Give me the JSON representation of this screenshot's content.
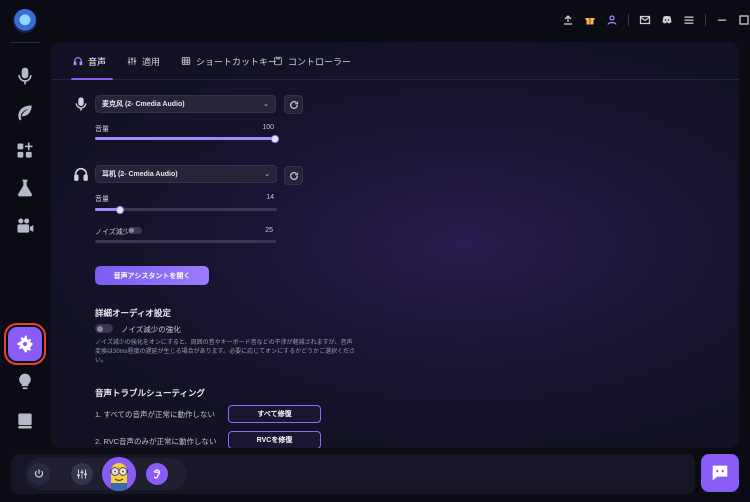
{
  "tabs": [
    {
      "label": "音声"
    },
    {
      "label": "適用"
    },
    {
      "label": "ショートカットキー"
    },
    {
      "label": "コントローラー"
    }
  ],
  "microphone": {
    "device": "麦克风 (2- Cmedia Audio)",
    "volume_label": "音量",
    "volume_value": "100",
    "volume_level": 1.0
  },
  "headphones": {
    "device": "耳机 (2- Cmedia Audio)",
    "volume_label": "音量",
    "volume_value": "14",
    "volume_level": 0.14,
    "noise_label": "ノイズ減少",
    "noise_value": "25",
    "noise_level": 0.0
  },
  "assistant_button": "音声アシスタントを開く",
  "advanced": {
    "title": "詳細オーディオ設定",
    "noise_boost_label": "ノイズ減少の強化",
    "description": "ノイズ減少の強化をオンにすると、周囲の音やキーボード音などの干渉が軽減されますが、音声変換は30ms程度の遅延が生じる場合があります。必要に応じてオンにするかどうかご選択ください。"
  },
  "troubleshoot": {
    "title": "音声トラブルシューティング",
    "rows": [
      {
        "text": "1. すべての音声が正常に動作しない",
        "button": "すべて修復"
      },
      {
        "text": "2. RVC音声のみが正常に動作しない",
        "button": "RVCを修復"
      }
    ]
  },
  "colors": {
    "accent": "#8a5cf6",
    "highlight": "#e0433a"
  }
}
